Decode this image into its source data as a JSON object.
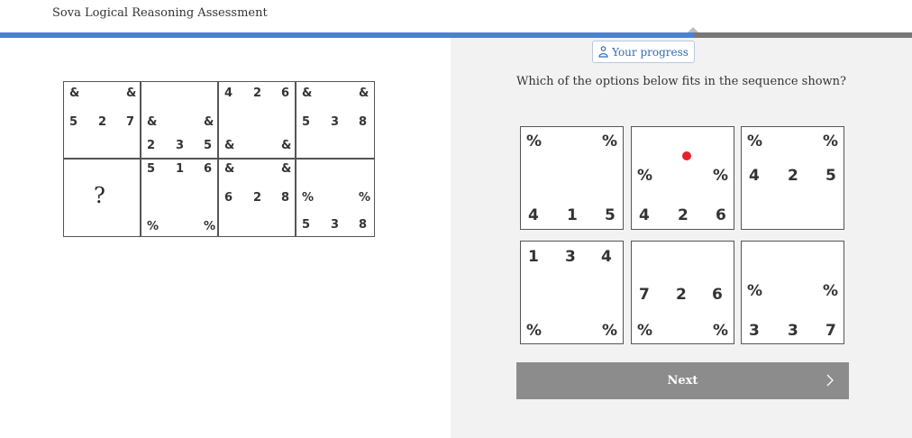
{
  "app": {
    "title": "Sova Logical Reasoning Assessment"
  },
  "progress": {
    "fraction": 0.76,
    "button_label": "Your progress",
    "icon": "person-icon",
    "accent": "#4a80d8"
  },
  "question": {
    "text": "Which of the options below fits in the sequence shown?"
  },
  "matrix": {
    "missing_symbol": "?",
    "cells": [
      [
        "&",
        "&",
        "5",
        "2",
        "7"
      ],
      [
        "&",
        "&",
        "2",
        "3",
        "5"
      ],
      [
        "4",
        "2",
        "6",
        "&",
        "&"
      ],
      [
        "&",
        "&",
        "5",
        "3",
        "8"
      ],
      [
        "5",
        "1",
        "6",
        "%",
        "%"
      ],
      [
        "&",
        "&",
        "6",
        "2",
        "8"
      ],
      [
        "%",
        "%",
        "5",
        "3",
        "8"
      ]
    ]
  },
  "options": [
    [
      "%",
      "%",
      "4",
      "1",
      "5"
    ],
    [
      "%",
      "%",
      "4",
      "2",
      "6"
    ],
    [
      "%",
      "%",
      "4",
      "2",
      "5"
    ],
    [
      "1",
      "3",
      "4",
      "%",
      "%"
    ],
    [
      "7",
      "2",
      "6",
      "%",
      "%"
    ],
    [
      "%",
      "%",
      "3",
      "3",
      "7"
    ]
  ],
  "selected_option_index": 1,
  "next": {
    "label": "Next",
    "icon": "chevron-right-icon"
  }
}
